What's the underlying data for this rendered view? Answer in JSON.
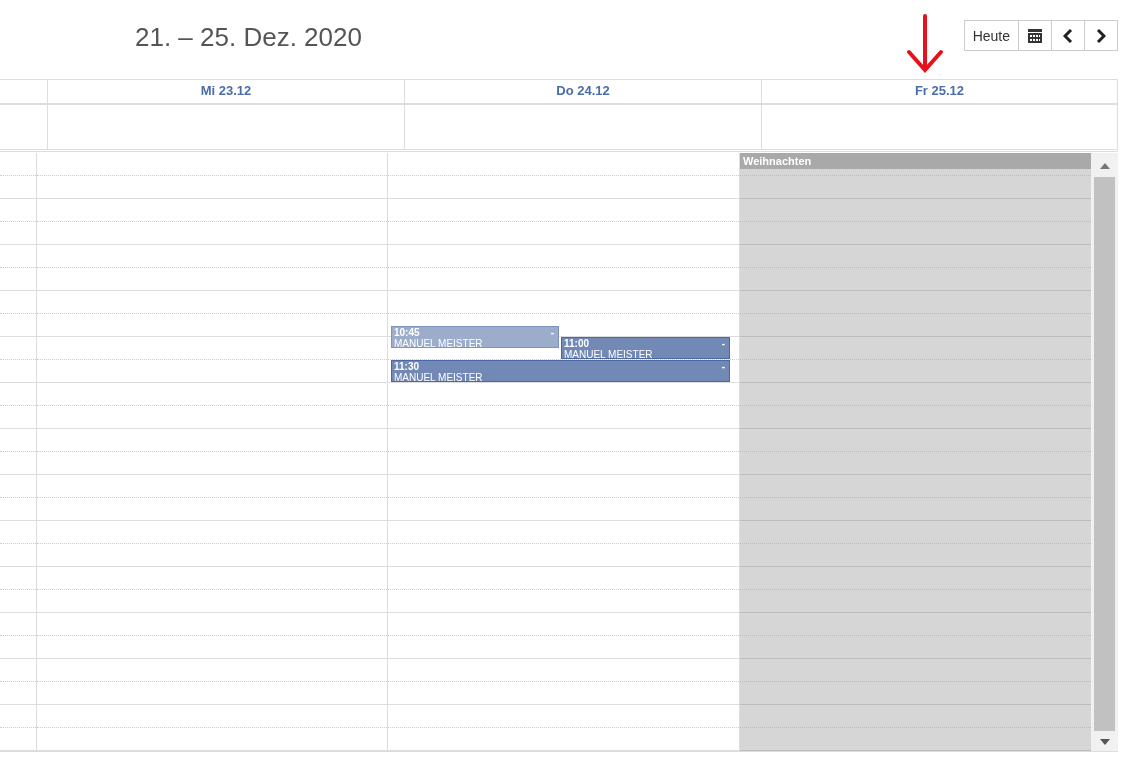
{
  "title": "21. – 25. Dez. 2020",
  "toolbar": [
    {
      "kind": "text",
      "label": "Heute"
    },
    {
      "kind": "calendar"
    },
    {
      "kind": "prev"
    },
    {
      "kind": "next"
    }
  ],
  "days": [
    {
      "label": "Mi 23.12"
    },
    {
      "label": "Do 24.12",
      "events": [
        {
          "time": "10:45",
          "name": "MANUEL MEISTER",
          "mark": "-",
          "muted": true
        },
        {
          "time": "11:00",
          "name": "MANUEL MEISTER",
          "mark": "-",
          "muted": false
        },
        {
          "time": "11:30",
          "name": "MANUEL MEISTER",
          "mark": "-",
          "muted": false
        }
      ]
    },
    {
      "label": "Fr 25.12",
      "holiday": "Weihnachten"
    }
  ]
}
